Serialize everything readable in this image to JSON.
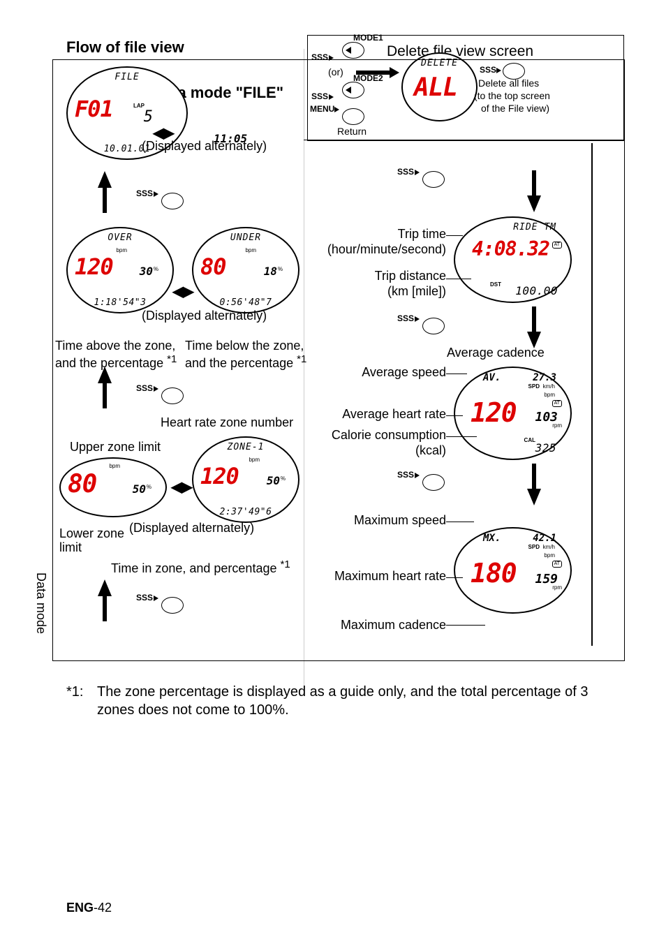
{
  "header": {
    "title": "Flow of file view",
    "mode_label": "Data mode \"FILE\"",
    "delete_title": "Delete file view screen"
  },
  "buttons": {
    "sss": "SSS",
    "mode1": "MODE1",
    "mode2": "MODE2",
    "menu": "MENU",
    "return": "Return",
    "or": "(or)"
  },
  "screens": {
    "file": {
      "top": "FILE",
      "big": "F01",
      "lap_lbl": "LAP",
      "lap": "5",
      "date": "10.01.01",
      "time": "11:05",
      "alt": "(Displayed alternately)"
    },
    "delete": {
      "top": "DELETE",
      "big": "ALL",
      "note1": "Delete all files",
      "note2": "(to the top screen",
      "note3": "of the File view)"
    },
    "over": {
      "top": "OVER",
      "big": "120",
      "pct": "30",
      "pct_unit": "%",
      "bpm": "bpm",
      "time": "1:18'54\"3"
    },
    "under": {
      "top": "UNDER",
      "big": "80",
      "pct": "18",
      "pct_unit": "%",
      "bpm": "bpm",
      "time": "0:56'48\"7"
    },
    "zone_left": {
      "big": "80",
      "pct": "50",
      "pct_unit": "%",
      "bpm": "bpm"
    },
    "zone_right": {
      "top": "ZONE-1",
      "big": "120",
      "pct": "50",
      "pct_unit": "%",
      "bpm": "bpm",
      "time": "2:37'49\"6"
    },
    "ride": {
      "top": "RIDE TM",
      "big": "4:08.32",
      "dst_lbl": "DST",
      "dst": "100.00"
    },
    "avg": {
      "top": "AV.",
      "spd": "27.3",
      "spd_lbl": "SPD",
      "spd_unit": "km/h",
      "big": "120",
      "bpm": "bpm",
      "cad": "103",
      "cad_unit": "rpm",
      "cal": "325",
      "cal_lbl": "CAL"
    },
    "max": {
      "top": "MX.",
      "spd": "42.1",
      "spd_lbl": "SPD",
      "spd_unit": "km/h",
      "big": "180",
      "bpm": "bpm",
      "cad": "159",
      "cad_unit": "rpm"
    }
  },
  "labels": {
    "over_desc": "Time above the zone, and the percentage",
    "under_desc": "Time below the zone, and the percentage",
    "hr_zone_num": "Heart rate zone number",
    "upper_limit": "Upper zone limit",
    "lower_limit": "Lower zone limit",
    "time_in_zone": "Time in zone, and percentage",
    "trip_time": "Trip time",
    "trip_time_unit": "(hour/minute/second)",
    "trip_dist": "Trip distance",
    "trip_dist_unit": "(km [mile])",
    "avg_speed": "Average speed",
    "avg_cadence": "Average cadence",
    "avg_hr": "Average heart rate",
    "cal": "Calorie consumption",
    "cal_unit": "(kcal)",
    "max_speed": "Maximum speed",
    "max_hr": "Maximum heart rate",
    "max_cadence": "Maximum cadence",
    "displayed_alt": "(Displayed alternately)",
    "star1": "*1",
    "star1_sup": "*1"
  },
  "footnote": {
    "mark": "*1:",
    "text": "The zone percentage is displayed as a guide only, and the total percentage of 3 zones does not come to 100%."
  },
  "sidebar": "Data mode",
  "page": {
    "prefix": "ENG",
    "num": "-42"
  }
}
